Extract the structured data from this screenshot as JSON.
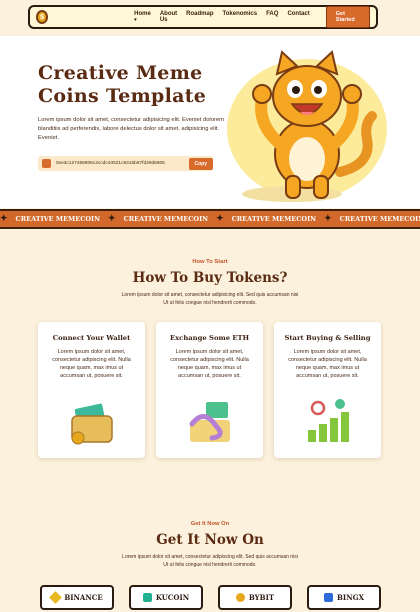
{
  "nav": {
    "logo_icon": "coin-logo-icon",
    "items": [
      "Home",
      "About Us",
      "Roadmap",
      "Tokenomics",
      "FAQ",
      "Contact"
    ],
    "home_caret": "▾",
    "cta": "Get Started"
  },
  "hero": {
    "title_line1": "Creative Meme",
    "title_line2": "Coins Template",
    "description": "Lorem ipsum dolor sit amet, consectetur adipisicing elit. Eveniet dolorem blanditiis ad perferendis, labore delectus dolor sit amet, adipisicing elit. Eveniet.",
    "address": "0xe3c127466906c2ccdc43521c8315b67fd39d6605",
    "copy_label": "Copy",
    "mascot_icon": "cat-mascot-icon"
  },
  "ticker": {
    "text": "CREATIVE MEMECOIN",
    "separator_icon": "star-icon"
  },
  "how_to": {
    "subtitle": "How To Start",
    "title": "How To Buy Tokens?",
    "description": "Lorem ipsum dolor sit amet, consectetur adipisicing elit. Sed quis accumsan nisi Ut ut felis congue nisl hendrerit commodo.",
    "cards": [
      {
        "title": "Connect Your Wallet",
        "text": "Lorem ipsum dolor sit amet, consectetur adipiscing elit. Nulla neque quam, max imus ut accumsan ut, posuere sit.",
        "icon": "wallet-icon"
      },
      {
        "title": "Exchange Some ETH",
        "text": "Lorem ipsum dolor sit amet, consectetur adipiscing elit. Nulla neque quam, max imus ut accumsan ut, posuere sit.",
        "icon": "money-exchange-icon"
      },
      {
        "title": "Start Buying & Selling",
        "text": "Lorem ipsum dolor sit amet, consectetur adipiscing elit. Nulla neque quam, max imus ut accumsan ut, posuere sit.",
        "icon": "growth-chart-icon"
      }
    ]
  },
  "get_it": {
    "subtitle": "Get It Now On",
    "title": "Get It Now On",
    "description": "Lorem ipsum dolor sit amet, consectetur adipiscing elit. Sed quis accumsan nisi Ut ut felis congue nisl hendrerit commodo.",
    "exchanges": [
      {
        "name": "BINANCE",
        "icon": "binance-icon",
        "color": "#e8b820"
      },
      {
        "name": "KUCOIN",
        "icon": "kucoin-icon",
        "color": "#23af91"
      },
      {
        "name": "BYBIT",
        "icon": "bybit-icon",
        "color": "#e8a81e"
      },
      {
        "name": "BINGX",
        "icon": "bingx-icon",
        "color": "#2f6bd8"
      }
    ]
  },
  "colors": {
    "brand_orange": "#d86a2c",
    "brown_text": "#5a2a12",
    "cream_bg": "#fbf1dc"
  }
}
